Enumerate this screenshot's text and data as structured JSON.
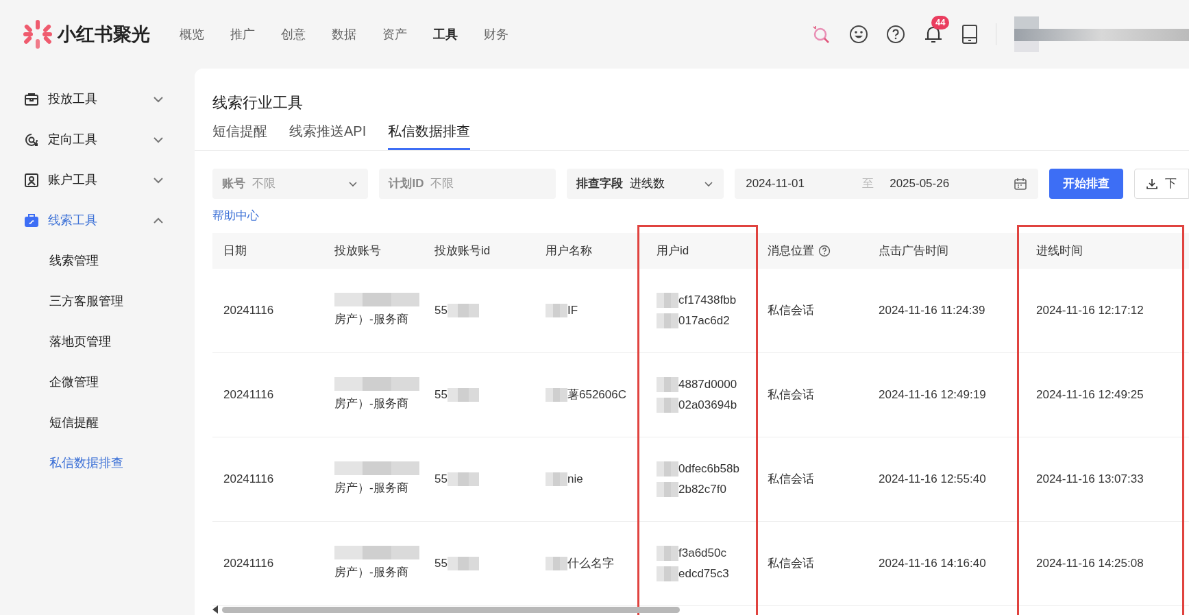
{
  "header": {
    "logo": "小红书聚光",
    "nav": [
      {
        "label": "概览",
        "selected": false
      },
      {
        "label": "推广",
        "selected": false
      },
      {
        "label": "创意",
        "selected": false
      },
      {
        "label": "数据",
        "selected": false
      },
      {
        "label": "资产",
        "selected": false
      },
      {
        "label": "工具",
        "selected": true
      },
      {
        "label": "财务",
        "selected": false
      }
    ],
    "notification_count": "44"
  },
  "sidebar": {
    "items": [
      {
        "label": "投放工具",
        "expanded": false,
        "selected": false
      },
      {
        "label": "定向工具",
        "expanded": false,
        "selected": false
      },
      {
        "label": "账户工具",
        "expanded": false,
        "selected": false
      },
      {
        "label": "线索工具",
        "expanded": true,
        "selected": true,
        "children": [
          {
            "label": "线索管理",
            "selected": false
          },
          {
            "label": "三方客服管理",
            "selected": false
          },
          {
            "label": "落地页管理",
            "selected": false
          },
          {
            "label": "企微管理",
            "selected": false
          },
          {
            "label": "短信提醒",
            "selected": false
          },
          {
            "label": "私信数据排查",
            "selected": true
          }
        ]
      }
    ]
  },
  "page": {
    "title": "线索行业工具",
    "tabs": [
      {
        "label": "短信提醒",
        "selected": false
      },
      {
        "label": "线索推送API",
        "selected": false
      },
      {
        "label": "私信数据排查",
        "selected": true
      }
    ],
    "filters": [
      {
        "kind": "select",
        "label": "账号",
        "placeholder": "不限"
      },
      {
        "kind": "input",
        "label": "计划ID",
        "placeholder": "不限"
      },
      {
        "kind": "select",
        "label": "排查字段",
        "value": "进线数"
      }
    ],
    "date_range": {
      "start": "2024-11-01",
      "separator": "至",
      "end": "2025-05-26"
    },
    "search_button": "开始排查",
    "download_button": "下",
    "help_link": "帮助中心"
  },
  "table": {
    "columns": [
      {
        "label": "日期",
        "highlighted": false
      },
      {
        "label": "投放账号",
        "highlighted": false
      },
      {
        "label": "投放账号id",
        "highlighted": false
      },
      {
        "label": "用户名称",
        "highlighted": false
      },
      {
        "label": "用户id",
        "highlighted": true
      },
      {
        "label": "消息位置",
        "highlighted": false
      },
      {
        "label": "点击广告时间",
        "highlighted": false
      },
      {
        "label": "进线时间",
        "highlighted": true
      }
    ],
    "rows": [
      {
        "date": "20241116",
        "account": "房产）-服务商",
        "account_id": "55",
        "user_name": "IF",
        "user_id": [
          "cf17438fbb",
          "017ac6d2"
        ],
        "position": "私信会话",
        "click_time": "2024-11-16 11:24:39",
        "entry_time": "2024-11-16 12:17:12"
      },
      {
        "date": "20241116",
        "account": "房产）-服务商",
        "account_id": "55",
        "user_name": "薯652606C",
        "user_id": [
          "4887d0000",
          "02a03694b"
        ],
        "position": "私信会话",
        "click_time": "2024-11-16 12:49:19",
        "entry_time": "2024-11-16 12:49:25"
      },
      {
        "date": "20241116",
        "account": "房产）-服务商",
        "account_id": "55",
        "user_name": "nie",
        "user_id": [
          "0dfec6b58b",
          "2b82c7f0"
        ],
        "position": "私信会话",
        "click_time": "2024-11-16 12:55:40",
        "entry_time": "2024-11-16 13:07:33"
      },
      {
        "date": "20241116",
        "account": "房产）-服务商",
        "account_id": "55",
        "user_name": "什么名字",
        "user_id": [
          "f3a6d50c",
          "edcd75c3"
        ],
        "position": "私信会话",
        "click_time": "2024-11-16 14:16:40",
        "entry_time": "2024-11-16 14:25:08"
      }
    ]
  }
}
